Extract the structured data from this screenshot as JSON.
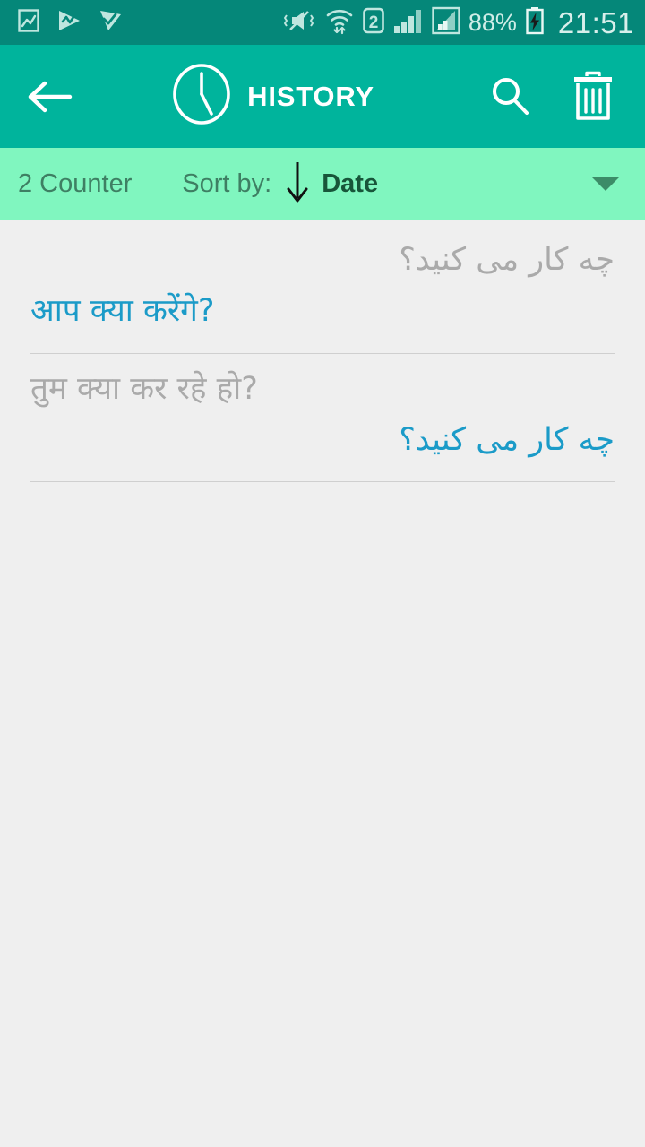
{
  "status_bar": {
    "time": "21:51",
    "battery_percent": "88%",
    "battery_state": "charging",
    "sim_label": "2",
    "notification_icons": [
      "gallery-image-icon",
      "media-play-icon",
      "media-check-icon"
    ],
    "system_icons": [
      "mute-vibrate-icon",
      "wifi-transfer-icon",
      "sim2-icon",
      "signal-bars-icon",
      "signal-box-icon",
      "battery-charging-icon"
    ],
    "background_color": "#058779",
    "foreground_color": "#CFEDE7"
  },
  "app_bar": {
    "back_label": "Back",
    "title": "HISTORY",
    "clock_icon": "clock-icon",
    "search_label": "Search",
    "delete_label": "Delete all",
    "background_color": "#00B49C",
    "title_color": "#FFFFFF"
  },
  "sort_bar": {
    "counter": "2 Counter",
    "sort_by_label": "Sort by:",
    "sort_direction": "descending",
    "sort_value": "Date",
    "dropdown_caret": "chevron-down-icon",
    "background_color": "#80F6BF",
    "label_color": "#3E7F63",
    "value_color": "#18563A"
  },
  "history": {
    "accent_color": "#1B9BC8",
    "muted_color": "#AAAAAA",
    "items": [
      {
        "source_text": "چه کار می کنید؟",
        "source_dir": "rtl",
        "source_tone": "muted",
        "target_text": "आप क्या करेंगे?",
        "target_dir": "ltr",
        "target_tone": "accent"
      },
      {
        "source_text": "तुम क्या कर रहे हो?",
        "source_dir": "ltr",
        "source_tone": "muted",
        "target_text": "چه کار می کنید؟",
        "target_dir": "rtl",
        "target_tone": "accent"
      }
    ]
  }
}
